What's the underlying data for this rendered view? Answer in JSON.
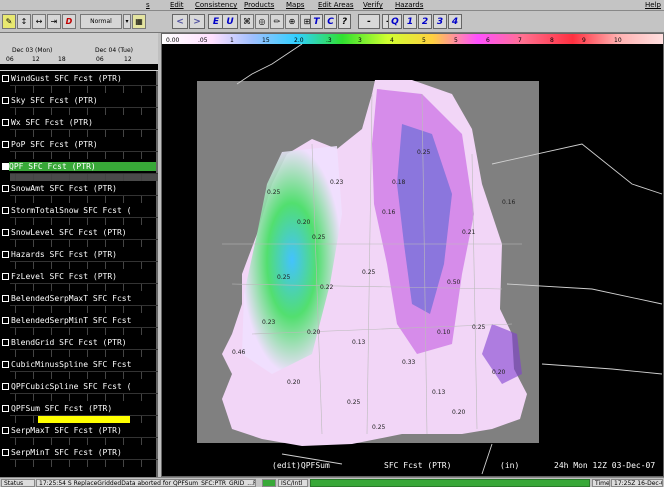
{
  "menubar": {
    "items": [
      {
        "label": "s"
      },
      {
        "label": "Edit"
      },
      {
        "label": "Consistency"
      },
      {
        "label": "Products"
      },
      {
        "label": "Maps"
      },
      {
        "label": "Edit Areas"
      },
      {
        "label": "Verify"
      },
      {
        "label": "Hazards"
      },
      {
        "label": "Help"
      }
    ]
  },
  "toolbar": {
    "mode_select": "Normal",
    "buttons": [
      "<",
      ">",
      "E",
      "U",
      "T",
      "C",
      "?",
      "-",
      "-",
      "Q",
      "1",
      "2",
      "3",
      "4"
    ]
  },
  "timeline": {
    "dates": [
      "Dec 03 (Mon)",
      "Dec 04 (Tue)"
    ],
    "hours": [
      "06",
      "12",
      "18",
      "06",
      "12"
    ]
  },
  "grids": [
    {
      "label": "WindGust SFC  Fcst (PTR)",
      "checked": false
    },
    {
      "label": "Sky SFC  Fcst (PTR)",
      "checked": false
    },
    {
      "label": "Wx SFC  Fcst (PTR)",
      "checked": false
    },
    {
      "label": "PoP SFC  Fcst (PTR)",
      "checked": false
    },
    {
      "label": "QPF SFC  Fcst (PTR)",
      "checked": true
    },
    {
      "label": "SnowAmt SFC  Fcst (PTR)",
      "checked": false
    },
    {
      "label": "StormTotalSnow SFC  Fcst (",
      "checked": false
    },
    {
      "label": "SnowLevel SFC  Fcst (PTR)",
      "checked": false
    },
    {
      "label": "Hazards SFC  Fcst (PTR)",
      "checked": false
    },
    {
      "label": "FzLevel SFC  Fcst (PTR)",
      "checked": false
    },
    {
      "label": "BelendedSerpMaxT SFC  Fcst",
      "checked": false
    },
    {
      "label": "BelendedSerpMinT SFC  Fcst",
      "checked": false
    },
    {
      "label": "BlendGrid SFC  Fcst (PTR)",
      "checked": false
    },
    {
      "label": "CubicMinusSpline SFC  Fcst",
      "checked": false
    },
    {
      "label": "QPFCubicSpline SFC  Fcst (",
      "checked": false
    },
    {
      "label": "QPFSum SFC  Fcst (PTR)",
      "checked": false
    },
    {
      "label": "SerpMaxT SFC  Fcst (PTR)",
      "checked": false
    },
    {
      "label": "SerpMinT SFC  Fcst (PTR)",
      "checked": false
    }
  ],
  "colorbar": {
    "labels": [
      "0.00",
      ".05",
      "1",
      "15",
      "2.0",
      ".3",
      "3",
      "4",
      "5",
      "5",
      "6",
      "7",
      "8",
      "9",
      "10"
    ]
  },
  "map": {
    "values": [
      "0.25",
      "0.20",
      "0.25",
      "0.23",
      "0.46",
      "0.23",
      "0.25",
      "0.22",
      "0.20",
      "0.20",
      "0.13",
      "0.33",
      "0.13",
      "0.25",
      "0.16",
      "0.21",
      "0.50",
      "0.25",
      "0.20",
      "0.25",
      "0.18",
      "0.10",
      "0.25",
      "0.20",
      "0.25",
      "0.16"
    ]
  },
  "status": {
    "left": "(edit)QPFSum",
    "center": "SFC Fcst (PTR)",
    "units": "(in)",
    "time": "24h Mon 12Z 03-Dec-07"
  },
  "bottombar": {
    "status_label": "Status",
    "message": "17:25:54 S ReplaceGriddedData aborted for QPFSum_SFC:PTR_GRID_...Fcst",
    "isc": "ISC/Intl",
    "time_label": "Time",
    "time": "17:25Z 16-Dec-07"
  },
  "colors": {
    "accent_green": "#38a838",
    "yellow": "#ffff00"
  }
}
